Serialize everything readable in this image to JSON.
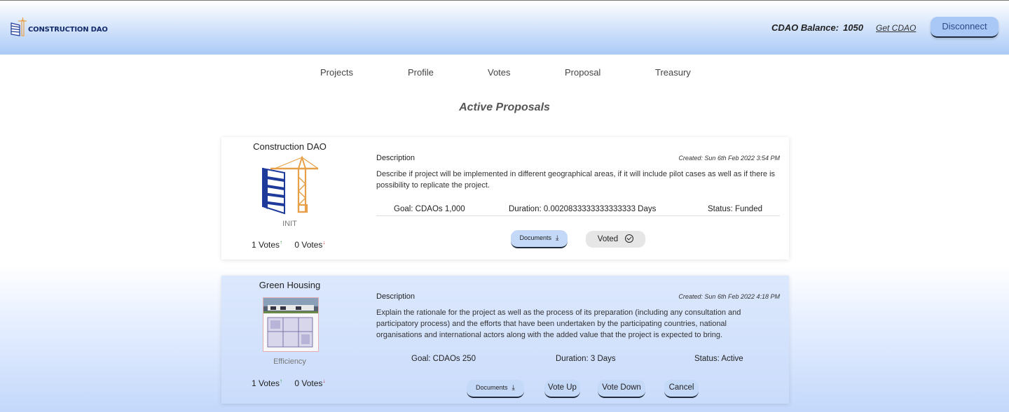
{
  "app": {
    "logo_text": "CONSTRUCTION DAO",
    "balance_label": "CDAO Balance:",
    "balance_value": "1050",
    "get_cdao": "Get CDAO",
    "disconnect": "Disconnect"
  },
  "nav": [
    "Projects",
    "Profile",
    "Votes",
    "Proposal",
    "Treasury"
  ],
  "page_title": "Active Proposals",
  "proposals": [
    {
      "name": "Construction DAO",
      "category": "INIT",
      "votes_up": "1 Votes",
      "votes_down": "0 Votes",
      "desc_label": "Description",
      "created": "Created:  Sun 6th Feb 2022 3:54 PM",
      "description": "Describe if project will be implemented in different geographical areas, if it will include pilot cases as well as if there is possibility to replicate the project.",
      "goal": "Goal:  CDAOs 1,000",
      "duration": "Duration: 0.0020833333333333333 Days",
      "status": "Status: Funded",
      "documents": "Documents",
      "voted": "Voted"
    },
    {
      "name": "Green Housing",
      "category": "Efficiency",
      "votes_up": "1 Votes",
      "votes_down": "0 Votes",
      "desc_label": "Description",
      "created": "Created:  Sun 6th Feb 2022 4:18 PM",
      "description": "Explain the rationale for the project as well as the process of its preparation (including any consultation and participatory process) and the efforts that have been undertaken by the participating countries, national organisations and international actors along with the added value that the project is expected to bring.",
      "goal": "Goal:  CDAOs 250",
      "duration": "Duration: 3 Days",
      "status": "Status: Active",
      "documents": "Documents",
      "vote_up": "Vote Up",
      "vote_down": "Vote Down",
      "cancel": "Cancel"
    }
  ],
  "arrows": {
    "up": "↑",
    "down": "↓",
    "download": "⤓"
  },
  "colors": {
    "accent": "#a9c8f6",
    "header_gradient_end": "#a9c9f7",
    "crane": "#e8a048",
    "building": "#1e3a9a"
  }
}
